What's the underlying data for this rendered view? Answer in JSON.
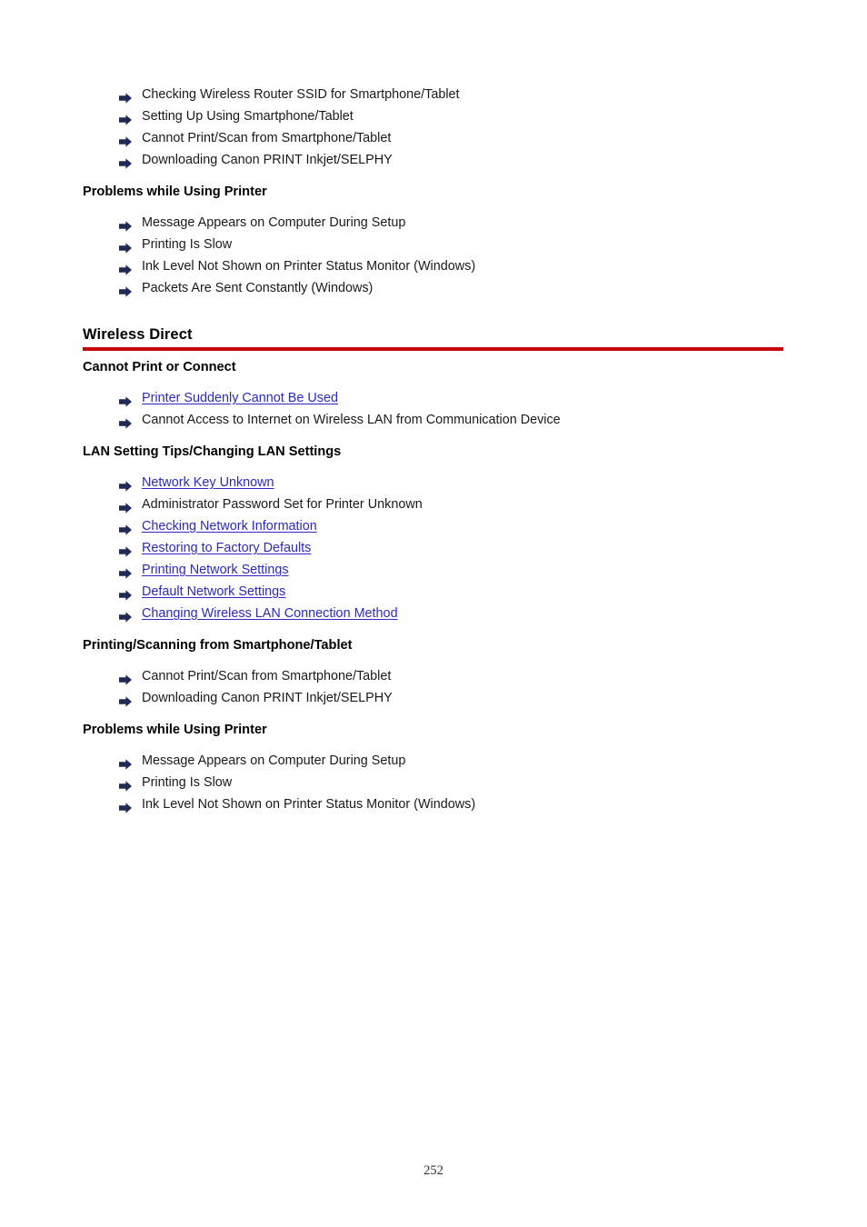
{
  "document": {
    "page_number": "252",
    "accent_rule_color": "#cc0000",
    "link_color": "#2a2ac0",
    "arrow_color": "#1f2a56"
  },
  "top_list": {
    "items": [
      {
        "label": "Checking Wireless Router SSID for Smartphone/Tablet",
        "is_link": false
      },
      {
        "label": "Setting Up Using Smartphone/Tablet",
        "is_link": false
      },
      {
        "label": "Cannot Print/Scan from Smartphone/Tablet",
        "is_link": false
      },
      {
        "label": "Downloading Canon PRINT Inkjet/SELPHY",
        "is_link": false
      }
    ]
  },
  "problems_printer_top": {
    "heading": "Problems while Using Printer",
    "items": [
      {
        "label": "Message Appears on Computer During Setup",
        "is_link": false
      },
      {
        "label": "Printing Is Slow",
        "is_link": false
      },
      {
        "label": "Ink Level Not Shown on Printer Status Monitor (Windows)",
        "is_link": false
      },
      {
        "label": "Packets Are Sent Constantly (Windows)",
        "is_link": false
      }
    ]
  },
  "wireless_direct": {
    "title": "Wireless Direct"
  },
  "cannot_print_or_connect": {
    "heading": "Cannot Print or Connect",
    "items": [
      {
        "label": "Printer Suddenly Cannot Be Used",
        "is_link": true
      },
      {
        "label": "Cannot Access to Internet on Wireless LAN from Communication Device",
        "is_link": false
      }
    ]
  },
  "lan_settings": {
    "heading": "LAN Setting Tips/Changing LAN Settings",
    "items": [
      {
        "label": "Network Key Unknown",
        "is_link": true
      },
      {
        "label": "Administrator Password Set for Printer Unknown",
        "is_link": false
      },
      {
        "label": "Checking Network Information",
        "is_link": true
      },
      {
        "label": "Restoring to Factory Defaults",
        "is_link": true
      },
      {
        "label": "Printing Network Settings",
        "is_link": true
      },
      {
        "label": "Default Network Settings",
        "is_link": true
      },
      {
        "label": "Changing Wireless LAN Connection Method",
        "is_link": true
      }
    ]
  },
  "printing_scanning_mobile": {
    "heading": "Printing/Scanning from Smartphone/Tablet",
    "items": [
      {
        "label": "Cannot Print/Scan from Smartphone/Tablet",
        "is_link": false
      },
      {
        "label": "Downloading Canon PRINT Inkjet/SELPHY",
        "is_link": false
      }
    ]
  },
  "problems_printer_bottom": {
    "heading": "Problems while Using Printer",
    "items": [
      {
        "label": "Message Appears on Computer During Setup",
        "is_link": false
      },
      {
        "label": "Printing Is Slow",
        "is_link": false
      },
      {
        "label": "Ink Level Not Shown on Printer Status Monitor (Windows)",
        "is_link": false
      }
    ]
  }
}
